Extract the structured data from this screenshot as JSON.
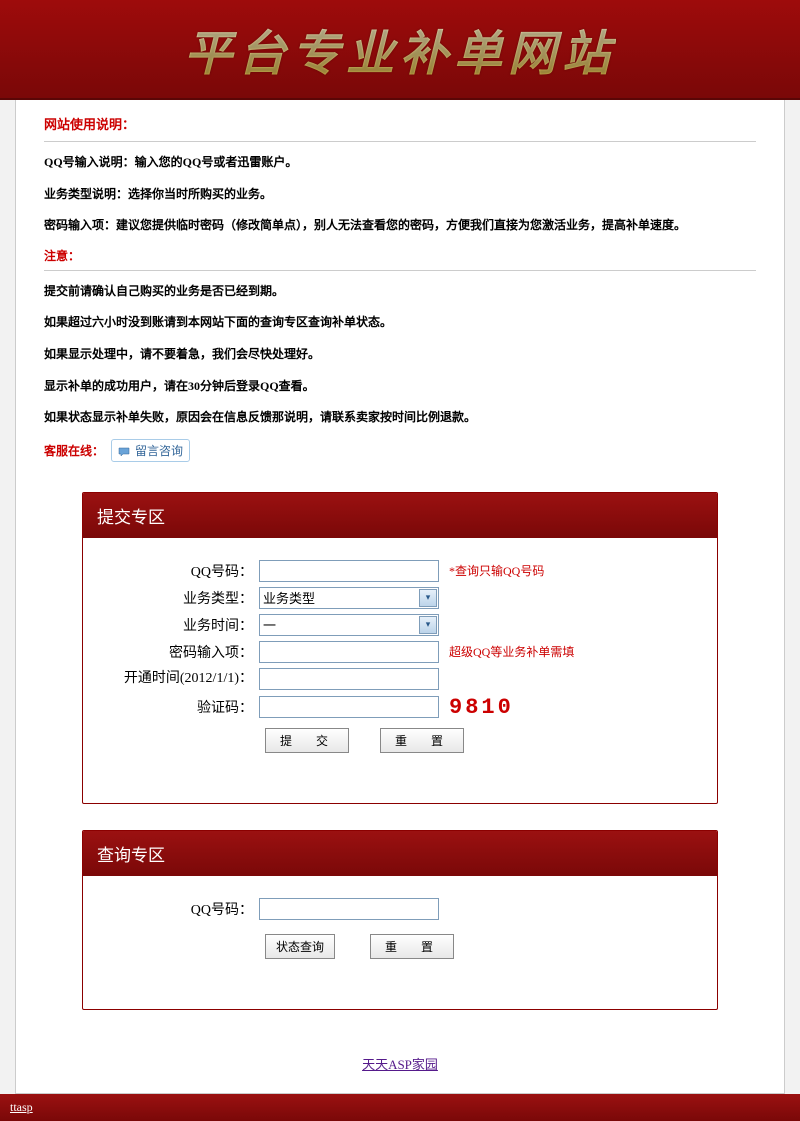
{
  "banner": {
    "title": "平台专业补单网站"
  },
  "intro": {
    "title": "网站使用说明：",
    "lines": [
      "QQ号输入说明：输入您的QQ号或者迅雷账户。",
      "业务类型说明：选择你当时所购买的业务。",
      "密码输入项：建议您提供临时密码（修改简单点），别人无法查看您的密码，方便我们直接为您激活业务，提高补单速度。"
    ],
    "notice_title": "注意：",
    "notice_lines": [
      "提交前请确认自己购买的业务是否已经到期。",
      "如果超过六小时没到账请到本网站下面的查询专区查询补单状态。",
      "如果显示处理中，请不要着急，我们会尽快处理好。",
      "显示补单的成功用户，请在30分钟后登录QQ查看。",
      "如果状态显示补单失败，原因会在信息反馈那说明，请联系卖家按时间比例退款。"
    ],
    "service_label": "客服在线：",
    "msg_btn": "留言咨询"
  },
  "submit_panel": {
    "header": "提交专区",
    "fields": {
      "qq_label": "QQ号码：",
      "qq_hint": "*查询只输QQ号码",
      "type_label": "业务类型：",
      "type_value": "业务类型",
      "time_label": "业务时间：",
      "time_value": "一",
      "password_label": "密码输入项：",
      "password_hint": "超级QQ等业务补单需填",
      "open_label": "开通时间(2012/1/1)：",
      "captcha_label": "验证码：",
      "captcha_value": "9810"
    },
    "submit_btn": "提　交",
    "reset_btn": "重　置"
  },
  "query_panel": {
    "header": "查询专区",
    "qq_label": "QQ号码：",
    "status_btn": "状态查询",
    "reset_btn": "重　置"
  },
  "footer": {
    "link": "天天ASP家园"
  },
  "bottom": {
    "link": "ttasp"
  }
}
